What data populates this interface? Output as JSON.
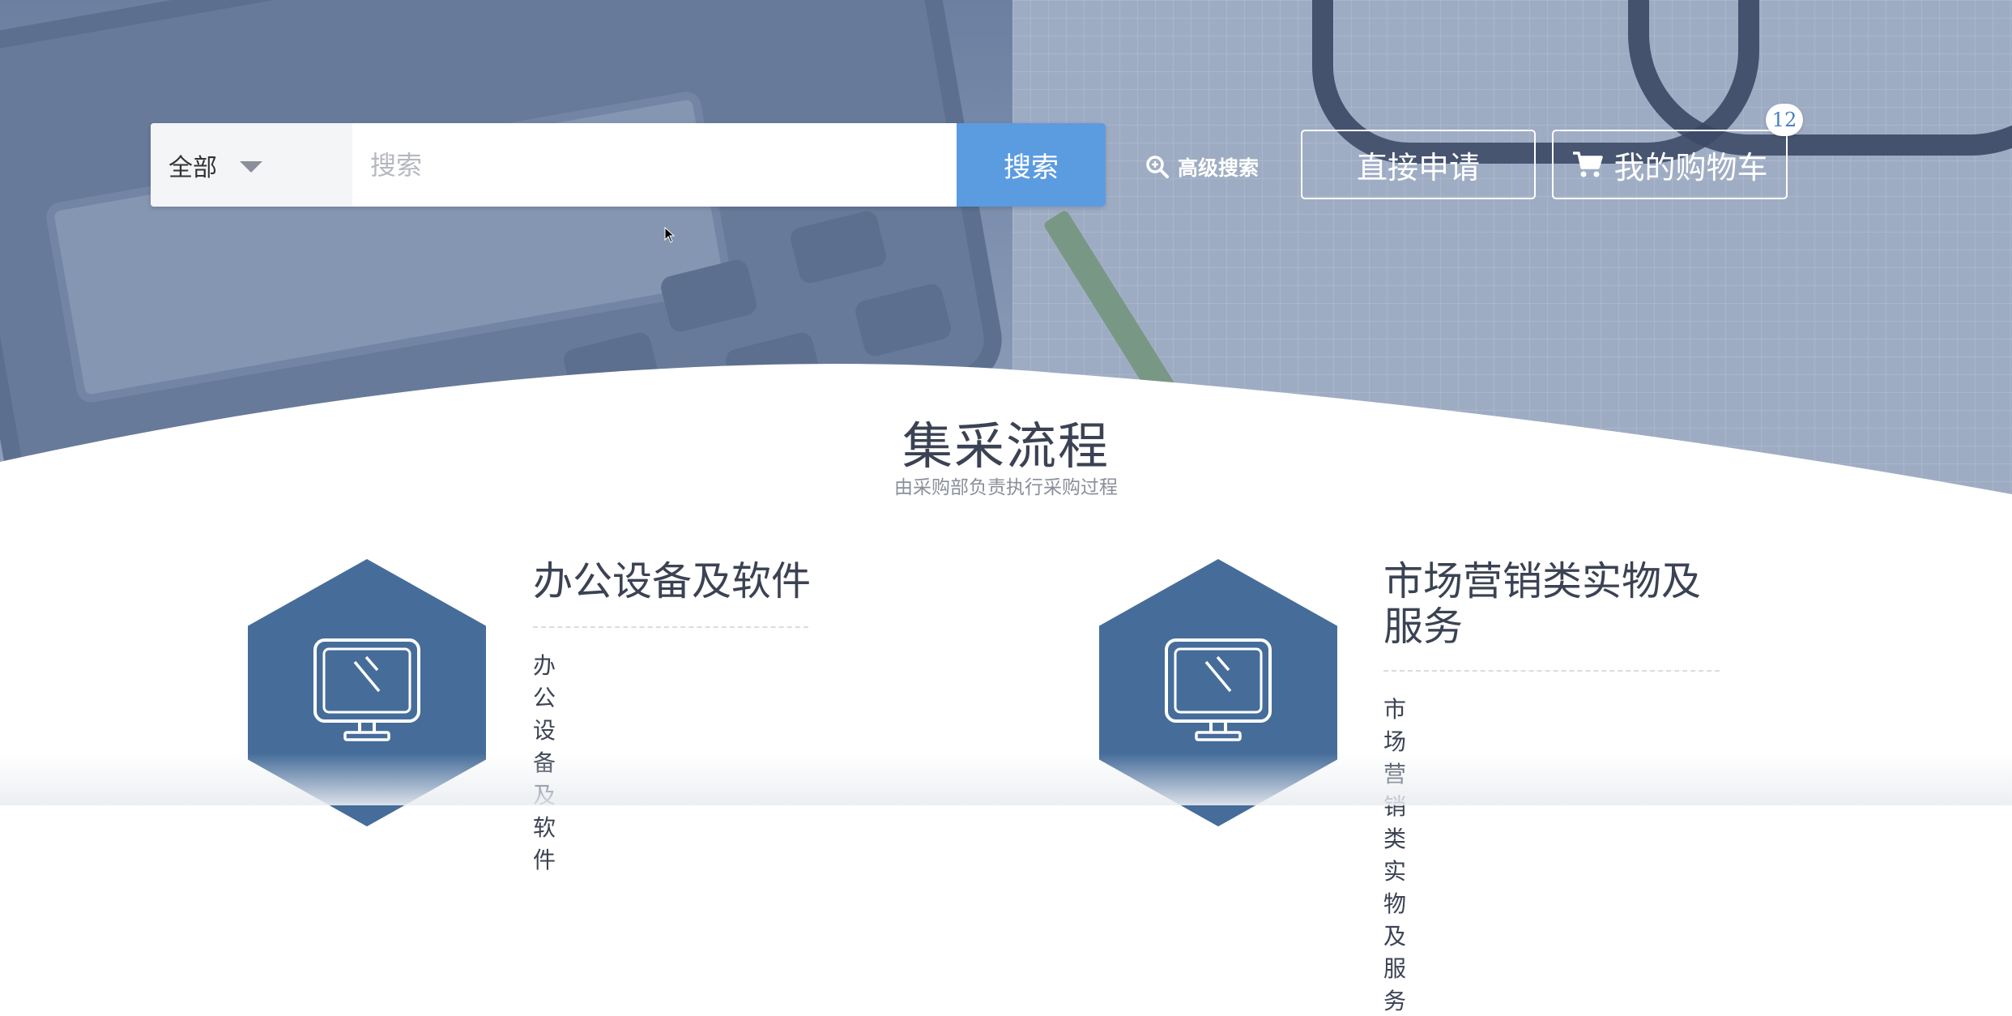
{
  "search": {
    "scope_label": "全部",
    "placeholder": "搜索",
    "value": "",
    "button_label": "搜索"
  },
  "header": {
    "advanced_search_label": "高级搜索",
    "apply_direct_label": "直接申请",
    "cart_label": "我的购物车",
    "cart_count": "12"
  },
  "section": {
    "title": "集采流程",
    "subtitle": "由采购部负责执行采购过程"
  },
  "cards": [
    {
      "title": "办公设备及软件",
      "description": "办公设备及软件",
      "icon": "monitor-icon"
    },
    {
      "title": "市场营销类实物及服务",
      "description": "市场营销类实物及服务",
      "icon": "monitor-icon"
    }
  ],
  "colors": {
    "accent": "#5b9be0",
    "hex_fill": "#466d9a",
    "title_text": "#3b4253",
    "subtitle_text": "#8a8f99"
  }
}
